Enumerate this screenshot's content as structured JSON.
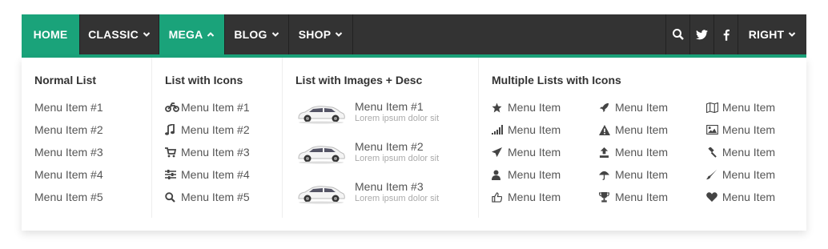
{
  "nav": {
    "home": "HOME",
    "classic": "CLASSIC",
    "mega": "MEGA",
    "blog": "BLOG",
    "shop": "SHOP",
    "right": "RIGHT"
  },
  "colors": {
    "accent": "#1aa37a",
    "navbar": "#333333"
  },
  "mega": {
    "col1": {
      "title": "Normal List",
      "items": [
        "Menu Item #1",
        "Menu Item #2",
        "Menu Item #3",
        "Menu Item #4",
        "Menu Item #5"
      ]
    },
    "col2": {
      "title": "List with Icons",
      "items": [
        {
          "icon": "motorcycle-icon",
          "label": "Menu Item #1"
        },
        {
          "icon": "music-icon",
          "label": "Menu Item #2"
        },
        {
          "icon": "cart-icon",
          "label": "Menu Item #3"
        },
        {
          "icon": "sliders-icon",
          "label": "Menu Item #4"
        },
        {
          "icon": "search-icon",
          "label": "Menu Item #5"
        }
      ]
    },
    "col3": {
      "title": "List with Images + Desc",
      "items": [
        {
          "label": "Menu Item #1",
          "desc": "Lorem ipsum dolor sit"
        },
        {
          "label": "Menu Item #2",
          "desc": "Lorem ipsum dolor sit"
        },
        {
          "label": "Menu Item #3",
          "desc": "Lorem ipsum dolor sit"
        }
      ]
    },
    "col4": {
      "title": "Multiple Lists with Icons",
      "a": [
        {
          "icon": "star-icon",
          "label": "Menu Item"
        },
        {
          "icon": "signal-icon",
          "label": "Menu Item"
        },
        {
          "icon": "paper-plane-icon",
          "label": "Menu Item"
        },
        {
          "icon": "user-icon",
          "label": "Menu Item"
        },
        {
          "icon": "thumbs-up-icon",
          "label": "Menu Item"
        }
      ],
      "b": [
        {
          "icon": "rocket-icon",
          "label": "Menu Item"
        },
        {
          "icon": "warning-icon",
          "label": "Menu Item"
        },
        {
          "icon": "upload-icon",
          "label": "Menu Item"
        },
        {
          "icon": "umbrella-icon",
          "label": "Menu Item"
        },
        {
          "icon": "trophy-icon",
          "label": "Menu Item"
        }
      ],
      "c": [
        {
          "icon": "map-icon",
          "label": "Menu Item"
        },
        {
          "icon": "image-icon",
          "label": "Menu Item"
        },
        {
          "icon": "gavel-icon",
          "label": "Menu Item"
        },
        {
          "icon": "paint-brush-icon",
          "label": "Menu Item"
        },
        {
          "icon": "heart-icon",
          "label": "Menu Item"
        }
      ]
    }
  }
}
